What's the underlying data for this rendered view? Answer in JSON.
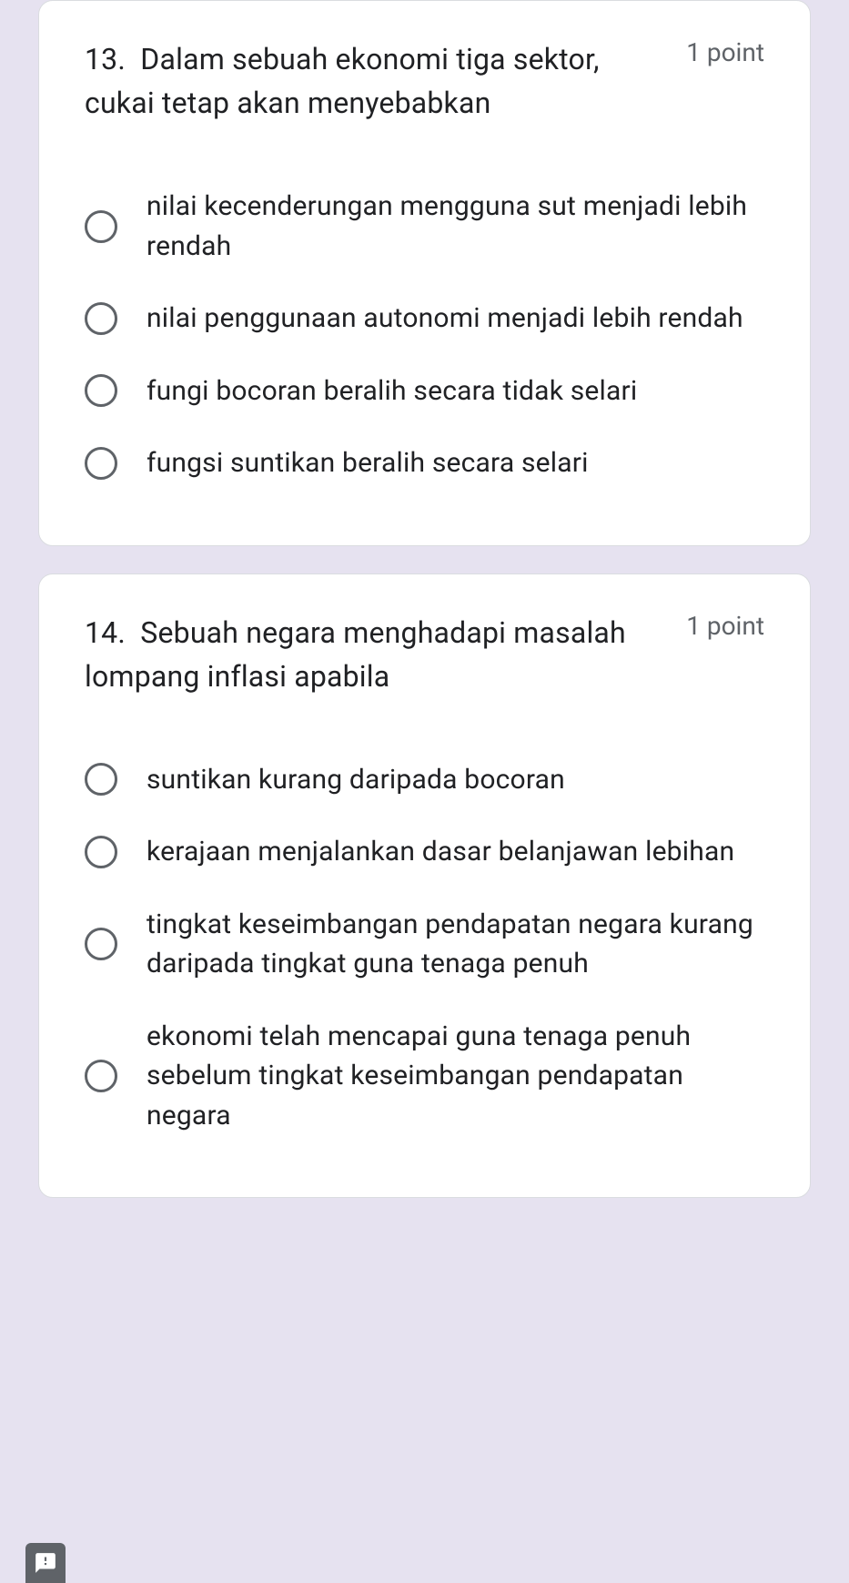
{
  "questions": [
    {
      "number": "13.",
      "text": "Dalam sebuah ekonomi tiga sektor, cukai tetap akan menyebabkan",
      "points": "1 point",
      "options": [
        "nilai kecenderungan mengguna sut menjadi lebih rendah",
        "nilai penggunaan autonomi menjadi lebih rendah",
        "fungi bocoran beralih secara tidak selari",
        "fungsi suntikan beralih secara selari"
      ]
    },
    {
      "number": "14.",
      "text": "Sebuah negara menghadapi masalah lompang inflasi apabila",
      "points": "1 point",
      "options": [
        "suntikan kurang daripada bocoran",
        "kerajaan menjalankan dasar belanjawan lebihan",
        "tingkat keseimbangan pendapatan negara kurang daripada tingkat guna tenaga penuh",
        "ekonomi telah mencapai guna tenaga penuh sebelum tingkat keseimbangan pendapatan negara"
      ]
    }
  ]
}
